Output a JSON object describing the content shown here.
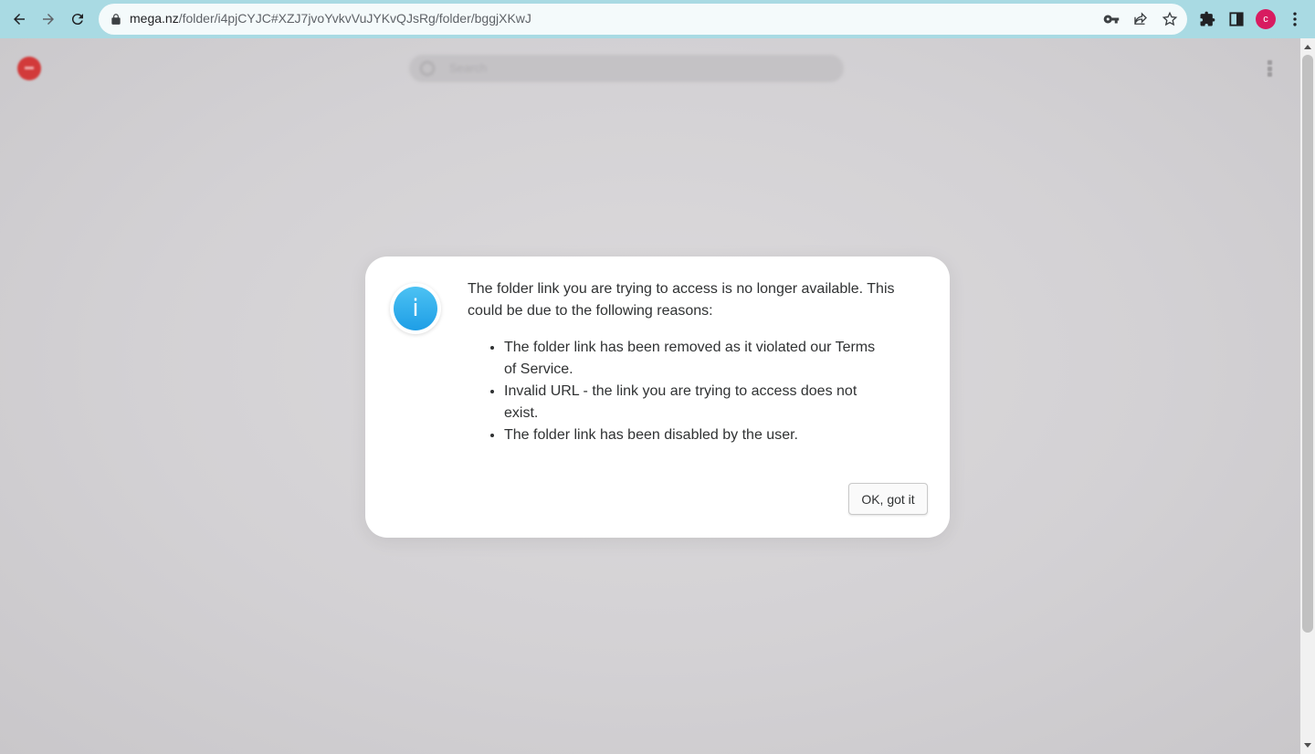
{
  "browser": {
    "url_host": "mega.nz",
    "url_path": "/folder/i4pjCYJC#XZJ7jvoYvkvVuJYKvQJsRg/folder/bggjXKwJ",
    "profile_initial": "c",
    "icons": [
      "back-icon",
      "forward-icon",
      "reload-icon",
      "lock-icon",
      "key-icon",
      "share-icon",
      "star-icon",
      "extensions-icon",
      "side-panel-icon",
      "menu-icon"
    ]
  },
  "app": {
    "search_placeholder": "Search"
  },
  "dialog": {
    "message": "The folder link you are trying to access is no longer available. This could be due to the following reasons:",
    "reasons": [
      "The folder link has been removed as it violated our Terms of Service.",
      "Invalid URL - the link you are trying to access does not exist.",
      "The folder link has been disabled by the user."
    ],
    "ok_label": "OK, got it",
    "info_glyph": "i",
    "accent_color": "#2aa6ea"
  }
}
